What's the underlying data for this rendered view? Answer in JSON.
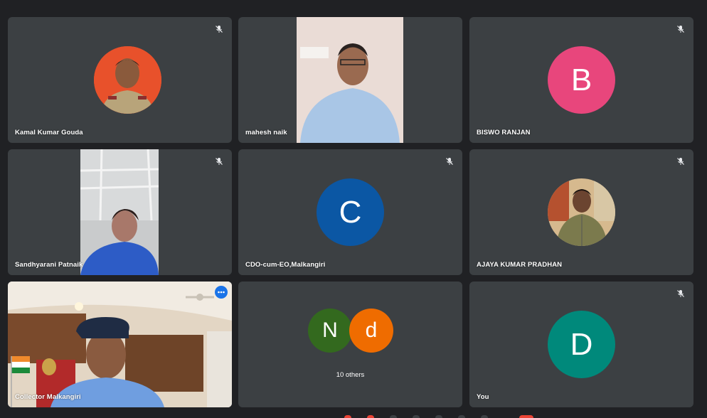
{
  "tiles": [
    {
      "name": "Kamal Kumar Gouda",
      "muted": true,
      "type": "photo",
      "bg": "#e8512b"
    },
    {
      "name": "mahesh naik",
      "muted": false,
      "type": "video"
    },
    {
      "name": "BISWO RANJAN",
      "muted": true,
      "type": "letter",
      "letter": "B",
      "bg": "#e8467c"
    },
    {
      "name": "Sandhyarani Patnaik",
      "muted": true,
      "type": "video"
    },
    {
      "name": "CDO-cum-EO,Malkangiri",
      "muted": true,
      "type": "letter",
      "letter": "C",
      "bg": "#0b57a4"
    },
    {
      "name": "AJAYA KUMAR PRADHAN",
      "muted": true,
      "type": "photo"
    },
    {
      "name": "Collector Malkangiri",
      "muted": false,
      "type": "video",
      "active": true
    },
    {
      "name": "10 others",
      "type": "group",
      "letters": [
        "N",
        "d"
      ],
      "colors": [
        "#33691e",
        "#ef6c00"
      ]
    },
    {
      "name": "You",
      "muted": true,
      "type": "letter",
      "letter": "D",
      "bg": "#00897b"
    }
  ],
  "colors": {
    "tile_bg": "#3c4043",
    "page_bg": "#202124",
    "active_outline": "#8ab4f8"
  },
  "icons": {
    "muted": "mic-off-icon",
    "more": "more-options-icon"
  }
}
